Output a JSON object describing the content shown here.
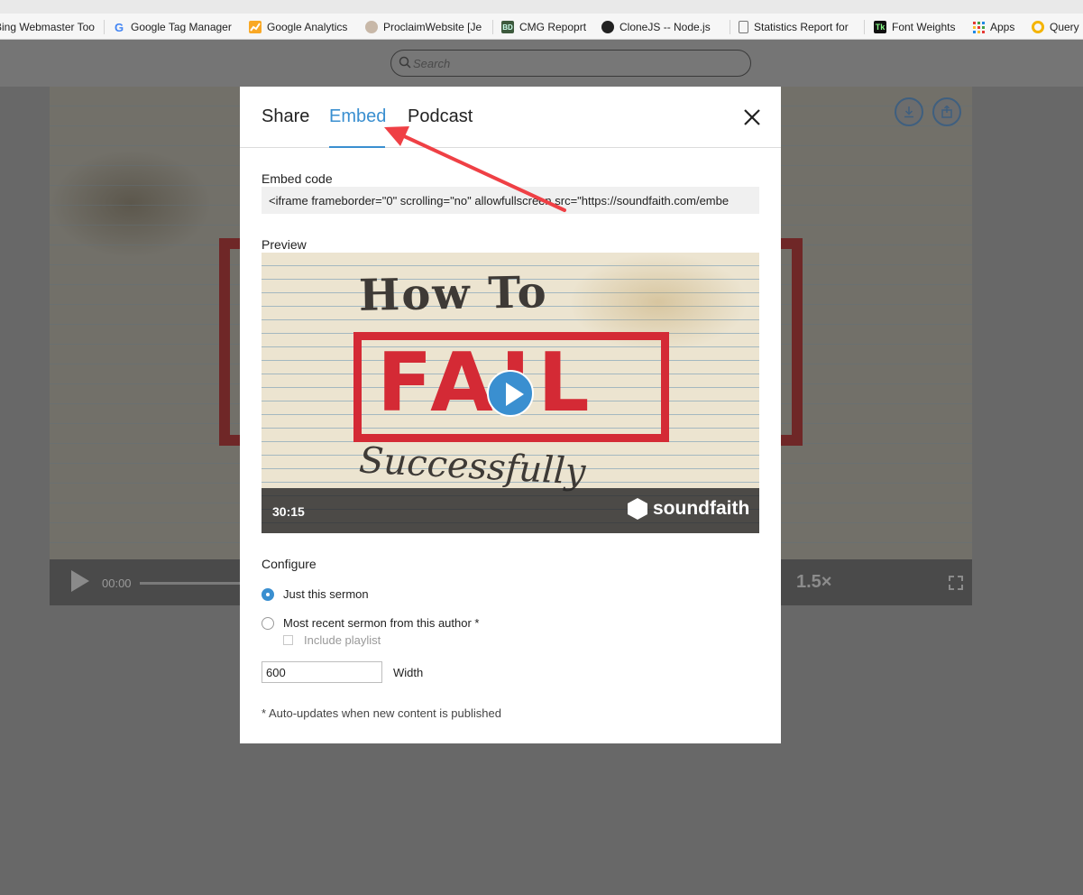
{
  "bookmarks": [
    {
      "label": "Bing Webmaster Too",
      "icon": "bing-icon"
    },
    {
      "label": "Google Tag Manager",
      "icon": "google-icon"
    },
    {
      "label": "Google Analytics",
      "icon": "analytics-icon"
    },
    {
      "label": "ProclaimWebsite [Je",
      "icon": "avatar-icon"
    },
    {
      "label": "CMG Repoprt",
      "icon": "bd-icon"
    },
    {
      "label": "CloneJS -- Node.js",
      "icon": "github-icon"
    },
    {
      "label": "Statistics Report for",
      "icon": "document-icon"
    },
    {
      "label": "Font Weights",
      "icon": "tk-icon"
    },
    {
      "label": "Apps",
      "icon": "apps-grid-icon"
    },
    {
      "label": "Query",
      "icon": "query-icon"
    }
  ],
  "search": {
    "placeholder": "Search"
  },
  "player": {
    "time": "00:00",
    "rate": "1.5×"
  },
  "modal": {
    "tabs": [
      "Share",
      "Embed",
      "Podcast"
    ],
    "active_tab": "Embed",
    "embed_label": "Embed code",
    "embed_code": "<iframe frameborder=\"0\" scrolling=\"no\" allowfullscreen src=\"https://soundfaith.com/embe",
    "preview_label": "Preview",
    "preview": {
      "title_top": "How To",
      "title_main": "FAIL",
      "title_bottom": "Successfully",
      "duration": "30:15",
      "brand": "soundfaith"
    },
    "configure_label": "Configure",
    "options": [
      {
        "label": "Just this sermon",
        "selected": true
      },
      {
        "label": "Most recent sermon from this author *",
        "selected": false
      }
    ],
    "include_playlist": "Include playlist",
    "width_value": "600",
    "width_label": "Width",
    "footnote": "* Auto-updates when new content is published"
  },
  "colors": {
    "accent": "#3a8fd0",
    "annotation_arrow": "#ef4045",
    "fail_red": "#d42a35"
  }
}
